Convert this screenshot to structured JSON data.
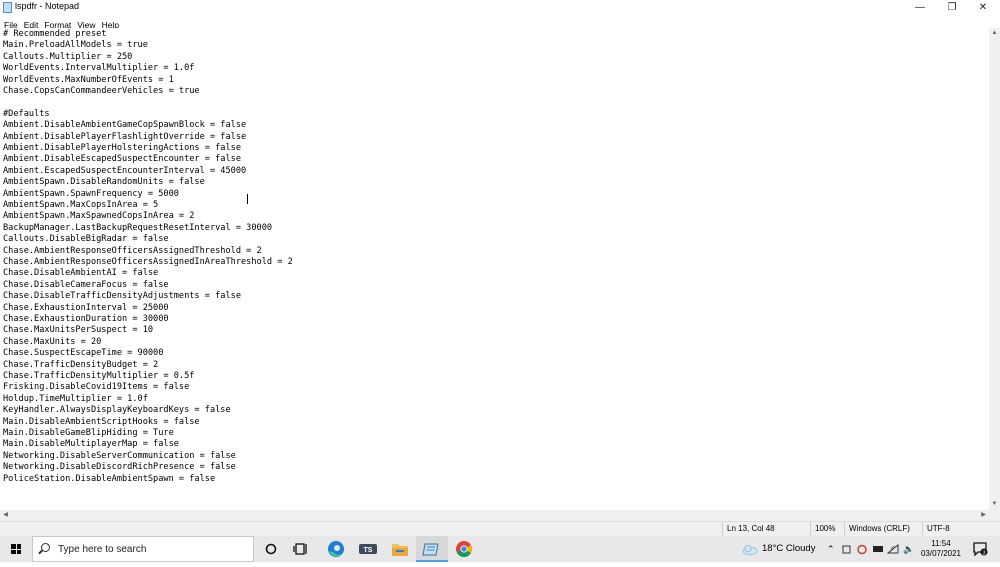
{
  "window": {
    "title": "lspdfr - Notepad",
    "minimize_glyph": "—",
    "maximize_glyph": "❐",
    "close_glyph": "✕"
  },
  "menu": [
    "File",
    "Edit",
    "Format",
    "View",
    "Help"
  ],
  "editor": {
    "lines": [
      "# Recommended preset",
      "Main.PreloadAllModels = true",
      "Callouts.Multiplier = 250",
      "WorldEvents.IntervalMultiplier = 1.0f",
      "WorldEvents.MaxNumberOfEvents = 1",
      "Chase.CopsCanCommandeerVehicles = true",
      "",
      "#Defaults",
      "Ambient.DisableAmbientGameCopSpawnBlock = false",
      "Ambient.DisablePlayerFlashlightOverride = false",
      "Ambient.DisablePlayerHolsteringActions = false",
      "Ambient.DisableEscapedSuspectEncounter = false",
      "Ambient.EscapedSuspectEncounterInterval = 45000",
      "AmbientSpawn.DisableRandomUnits = false",
      "AmbientSpawn.SpawnFrequency = 5000",
      "AmbientSpawn.MaxCopsInArea = 5",
      "AmbientSpawn.MaxSpawnedCopsInArea = 2",
      "BackupManager.LastBackupRequestResetInterval = 30000",
      "Callouts.DisableBigRadar = false",
      "Chase.AmbientResponseOfficersAssignedThreshold = 2",
      "Chase.AmbientResponseOfficersAssignedInAreaThreshold = 2",
      "Chase.DisableAmbientAI = false",
      "Chase.DisableCameraFocus = false",
      "Chase.DisableTrafficDensityAdjustments = false",
      "Chase.ExhaustionInterval = 25000",
      "Chase.ExhaustionDuration = 30000",
      "Chase.MaxUnitsPerSuspect = 10",
      "Chase.MaxUnits = 20",
      "Chase.SuspectEscapeTime = 90000",
      "Chase.TrafficDensityBudget = 2",
      "Chase.TrafficDensityMultiplier = 0.5f",
      "Frisking.DisableCovid19Items = false",
      "Holdup.TimeMultiplier = 1.0f",
      "KeyHandler.AlwaysDisplayKeyboardKeys = false",
      "Main.DisableAmbientScriptHooks = false",
      "Main.DisableGameBlipHiding = Ture",
      "Main.DisableMultiplayerMap = false",
      "Networking.DisableServerCommunication = false",
      "Networking.DisableDiscordRichPresence = false",
      "PoliceStation.DisableAmbientSpawn = false"
    ]
  },
  "status": {
    "position": "Ln 13, Col 48",
    "zoom": "100%",
    "line_ending": "Windows (CRLF)",
    "encoding": "UTF-8"
  },
  "taskbar": {
    "search_placeholder": "Type here to search",
    "weather": "18°C  Cloudy",
    "time": "11:54",
    "date": "03/07/2021",
    "notification_count": "3"
  },
  "colors": {
    "taskbar": "#e8e8e8",
    "accent": "#4f9ee8",
    "chrome_red": "#db4437",
    "chrome_yellow": "#f4b400",
    "chrome_green": "#0f9d58",
    "chrome_blue": "#4285f4",
    "edge_blue": "#1b7fd6",
    "edge_green": "#3ecf8e"
  },
  "icons": [
    "notepad-app-icon",
    "windows-start-icon",
    "search-icon",
    "cortana-icon",
    "task-view-icon",
    "edge-icon",
    "ts-app-icon",
    "file-explorer-icon",
    "notepad-taskbar-icon",
    "chrome-icon",
    "weather-cloud-icon",
    "chevron-up-icon",
    "network-icon",
    "volume-icon",
    "notification-icon"
  ]
}
